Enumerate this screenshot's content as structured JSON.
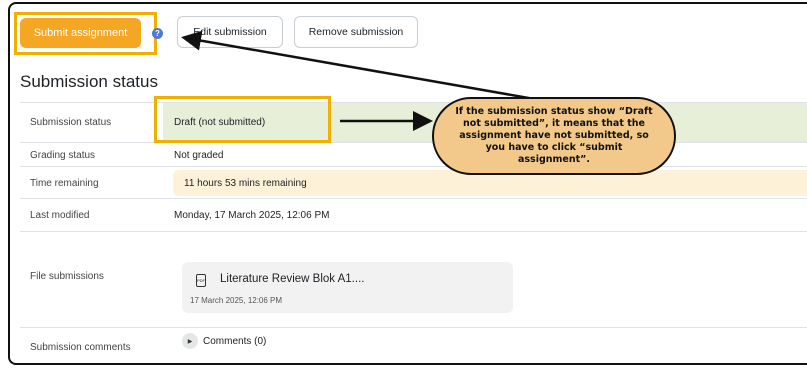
{
  "toolbar": {
    "submit_label": "Submit assignment",
    "edit_label": "Edit submission",
    "remove_label": "Remove submission",
    "help_glyph": "?"
  },
  "section": {
    "title": "Submission status"
  },
  "rows": [
    {
      "label": "Submission status",
      "value": "Draft (not submitted)"
    },
    {
      "label": "Grading status",
      "value": "Not graded"
    },
    {
      "label": "Time remaining",
      "value": "11 hours 53 mins remaining"
    },
    {
      "label": "Last modified",
      "value": "Monday, 17 March 2025, 12:06 PM"
    },
    {
      "label": "File submissions",
      "file_name": "Literature Review Blok A1....",
      "file_date": "17 March 2025, 12:06 PM",
      "file_icon_text": "PDF"
    },
    {
      "label": "Submission comments",
      "value": "Comments (0)"
    }
  ],
  "annotation": {
    "callout_text": "If the submission status show “Draft not submitted”, it means that the assignment have not submitted, so you have to click “submit assignment”.",
    "highlight_color": "#f0b000",
    "callout_color": "#f2c98a"
  },
  "colors": {
    "primary": "#f5a623",
    "status_bg": "#e8efd8",
    "time_bg": "#fdf1d8"
  }
}
